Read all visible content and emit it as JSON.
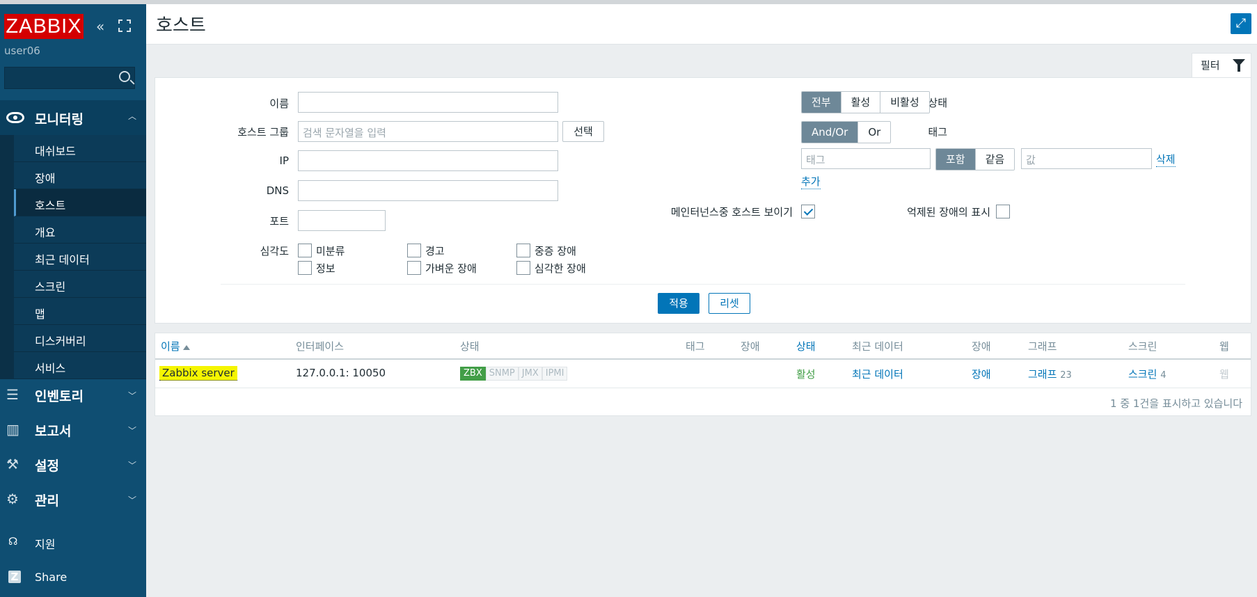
{
  "sidebar": {
    "logo": "ZABBIX",
    "username": "user06",
    "search_placeholder": "",
    "monitoring": {
      "label": "모니터링",
      "items": [
        {
          "label": "대쉬보드"
        },
        {
          "label": "장애"
        },
        {
          "label": "호스트"
        },
        {
          "label": "개요"
        },
        {
          "label": "최근 데이터"
        },
        {
          "label": "스크린"
        },
        {
          "label": "맵"
        },
        {
          "label": "디스커버리"
        },
        {
          "label": "서비스"
        }
      ]
    },
    "inventory": "인벤토리",
    "reports": "보고서",
    "configuration": "설정",
    "administration": "관리",
    "support": "지원",
    "share": "Share"
  },
  "header": {
    "title": "호스트"
  },
  "filter": {
    "tab_label": "필터",
    "name_label": "이름",
    "name_value": "",
    "hostgroup_label": "호스트 그룹",
    "hostgroup_placeholder": "검색 문자열을 입력",
    "select_button": "선택",
    "ip_label": "IP",
    "dns_label": "DNS",
    "port_label": "포트",
    "severity_label": "심각도",
    "severities": [
      {
        "label": "미분류"
      },
      {
        "label": "경고"
      },
      {
        "label": "중증 장애"
      },
      {
        "label": "정보"
      },
      {
        "label": "가벼운 장애"
      },
      {
        "label": "심각한 장애"
      }
    ],
    "status_label": "상태",
    "status_options": [
      "전부",
      "활성",
      "비활성"
    ],
    "status_selected": "전부",
    "tags_label": "태그",
    "tags_mode": [
      "And/Or",
      "Or"
    ],
    "tags_mode_selected": "And/Or",
    "tag_placeholder": "태그",
    "tag_operator": [
      "포함",
      "같음"
    ],
    "tag_operator_selected": "포함",
    "value_placeholder": "값",
    "remove_link": "삭제",
    "add_link": "추가",
    "maintenance_label": "메인터넌스중 호스트 보이기",
    "maintenance_checked": true,
    "suppressed_label": "억제된 장애의 표시",
    "suppressed_checked": false,
    "apply_button": "적용",
    "reset_button": "리셋"
  },
  "table": {
    "columns": [
      "이름",
      "인터페이스",
      "상태",
      "태그",
      "장애",
      "상태",
      "최근 데이터",
      "장애",
      "그래프",
      "스크린",
      "웹"
    ],
    "rows": [
      {
        "name": "Zabbix server",
        "interface": "127.0.0.1: 10050",
        "availability": [
          "ZBX",
          "SNMP",
          "JMX",
          "IPMI"
        ],
        "tags": "",
        "problems": "",
        "status": "활성",
        "latest_data": "최근 데이터",
        "problems_link": "장애",
        "graphs": "그래프",
        "graphs_count": "23",
        "screens": "스크린",
        "screens_count": "4",
        "web": "웹"
      }
    ],
    "footer": "1 중 1건을 표시하고 있습니다"
  },
  "colors": {
    "sidebar_bg": "#0f4e72",
    "logo_red": "#d40000",
    "accent_blue": "#0275b8",
    "status_green": "#429e47",
    "highlight_yellow": "#f5f500"
  }
}
